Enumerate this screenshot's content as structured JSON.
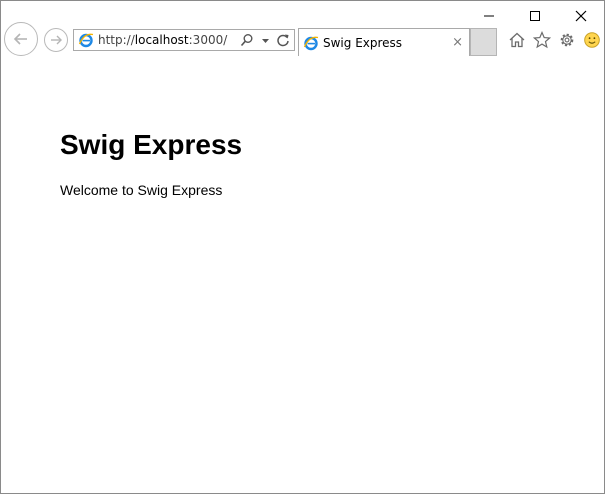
{
  "browser": {
    "caption_buttons": {
      "minimize_icon": "minimize-icon",
      "maximize_icon": "maximize-icon",
      "close_icon": "close-icon"
    },
    "address_bar": {
      "url_scheme": "http://",
      "url_host": "localhost",
      "url_rest": ":3000/"
    },
    "tab": {
      "title": "Swig Express",
      "close_glyph": "×"
    },
    "accent_color": "#1e88e5"
  },
  "page": {
    "heading": "Swig Express",
    "body_text": "Welcome to Swig Express"
  }
}
